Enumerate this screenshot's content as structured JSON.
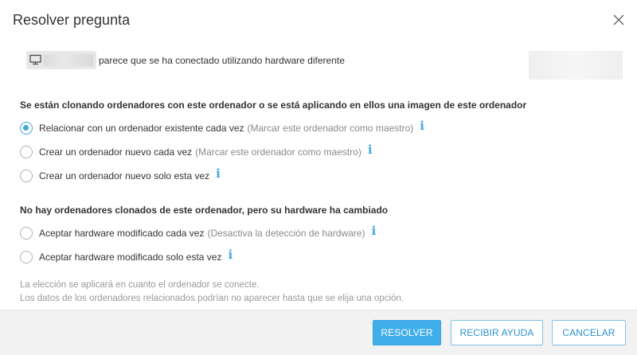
{
  "dialog": {
    "title": "Resolver pregunta"
  },
  "banner": {
    "machine_icon": "monitor-icon",
    "text": "parece que se ha conectado utilizando hardware diferente"
  },
  "sections": [
    {
      "title": "Se están clonando ordenadores con este ordenador o se está aplicando en ellos una imagen de este ordenador",
      "options": [
        {
          "label": "Relacionar con un ordenador existente cada vez",
          "note": "(Marcar este ordenador como maestro)",
          "checked": true
        },
        {
          "label": "Crear un ordenador nuevo cada vez",
          "note": "(Marcar este ordenador como maestro)",
          "checked": false
        },
        {
          "label": "Crear un ordenador nuevo solo esta vez",
          "note": "",
          "checked": false
        }
      ]
    },
    {
      "title": "No hay ordenadores clonados de este ordenador, pero su hardware ha cambiado",
      "options": [
        {
          "label": "Aceptar hardware modificado cada vez",
          "note": "(Desactiva la detección de hardware)",
          "checked": false
        },
        {
          "label": "Aceptar hardware modificado solo esta vez",
          "note": "",
          "checked": false
        }
      ]
    }
  ],
  "footnotes": [
    "La elección se aplicará en cuanto el ordenador se conecte.",
    "Los datos de los ordenadores relacionados podrían no aparecer hasta que se elija una opción."
  ],
  "buttons": {
    "resolve": "RESOLVER",
    "help": "RECIBIR AYUDA",
    "cancel": "CANCELAR"
  },
  "info_glyph": "i",
  "colors": {
    "accent": "#40aeea",
    "footer_bg": "#f2f2f2"
  }
}
